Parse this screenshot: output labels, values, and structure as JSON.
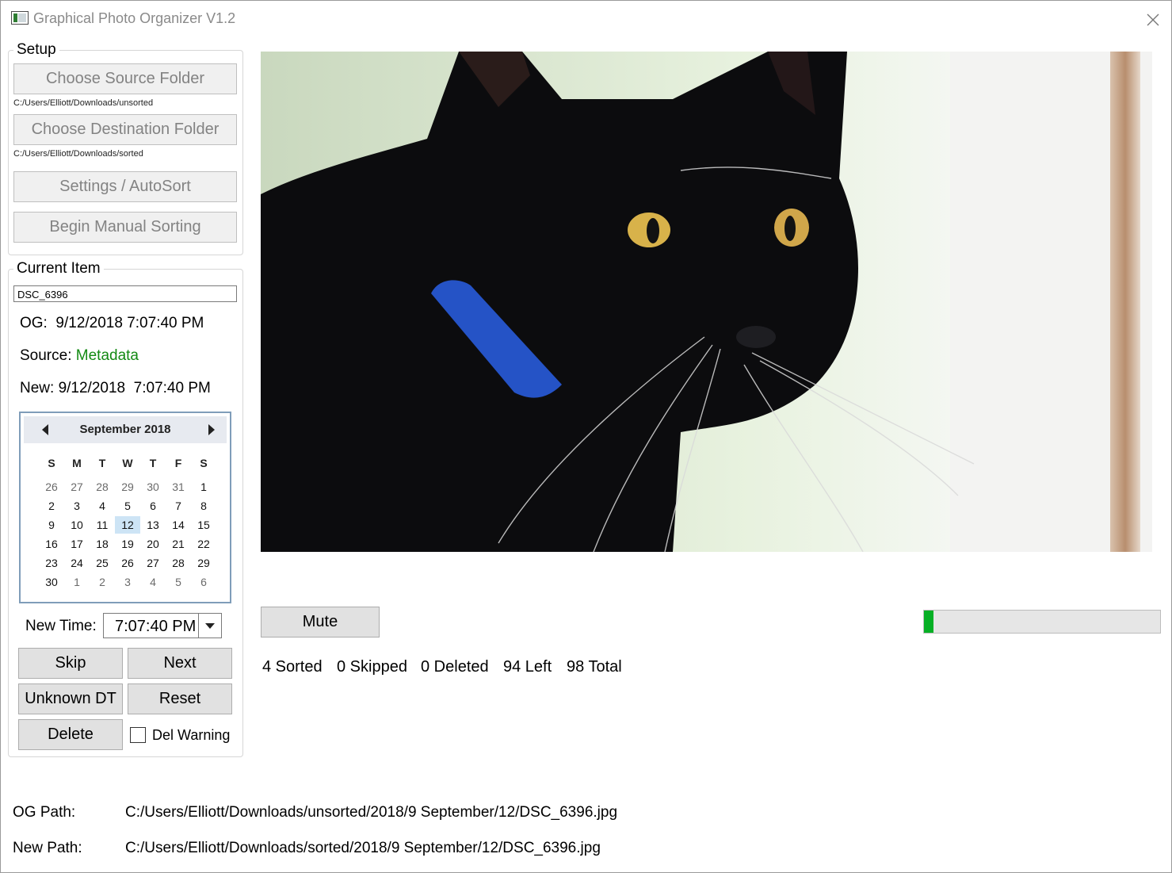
{
  "window": {
    "title": "Graphical Photo Organizer V1.2"
  },
  "setup": {
    "title": "Setup",
    "source_button": "Choose Source Folder",
    "source_path": "C:/Users/Elliott/Downloads/unsorted",
    "dest_button": "Choose Destination Folder",
    "dest_path": "C:/Users/Elliott/Downloads/sorted",
    "settings_button": "Settings / AutoSort",
    "begin_button": "Begin Manual Sorting"
  },
  "current": {
    "title": "Current Item",
    "filename": "DSC_6396",
    "og_label": "OG:",
    "og_value": "9/12/2018 7:07:40 PM",
    "source_label": "Source:",
    "source_value": "Metadata",
    "new_label": "New:",
    "new_value": "9/12/2018  7:07:40 PM"
  },
  "calendar": {
    "month": "September 2018",
    "days_of_week": [
      "S",
      "M",
      "T",
      "W",
      "T",
      "F",
      "S"
    ],
    "weeks": [
      [
        "26",
        "27",
        "28",
        "29",
        "30",
        "31",
        "1"
      ],
      [
        "2",
        "3",
        "4",
        "5",
        "6",
        "7",
        "8"
      ],
      [
        "9",
        "10",
        "11",
        "12",
        "13",
        "14",
        "15"
      ],
      [
        "16",
        "17",
        "18",
        "19",
        "20",
        "21",
        "22"
      ],
      [
        "23",
        "24",
        "25",
        "26",
        "27",
        "28",
        "29"
      ],
      [
        "30",
        "1",
        "2",
        "3",
        "4",
        "5",
        "6"
      ]
    ],
    "selected": "12"
  },
  "time": {
    "label": "New Time:",
    "value": "7:07:40 PM"
  },
  "actions": {
    "skip": "Skip",
    "next": "Next",
    "unknown": "Unknown DT",
    "reset": "Reset",
    "delete": "Delete",
    "del_warning": "Del Warning"
  },
  "media": {
    "mute": "Mute",
    "progress_fraction": 0.04
  },
  "stats": {
    "sorted": "4 Sorted",
    "skipped": "0 Skipped",
    "deleted": "0 Deleted",
    "left": "94 Left",
    "total": "98 Total"
  },
  "paths": {
    "og_label": "OG Path:",
    "og_value": "C:/Users/Elliott/Downloads/unsorted/2018/9 September/12/DSC_6396.jpg",
    "new_label": "New Path:",
    "new_value": "C:/Users/Elliott/Downloads/sorted/2018/9 September/12/DSC_6396.jpg"
  },
  "colors": {
    "progress": "#06b025",
    "source_value": "#138a13",
    "calendar_selected": "#cde4f5"
  }
}
